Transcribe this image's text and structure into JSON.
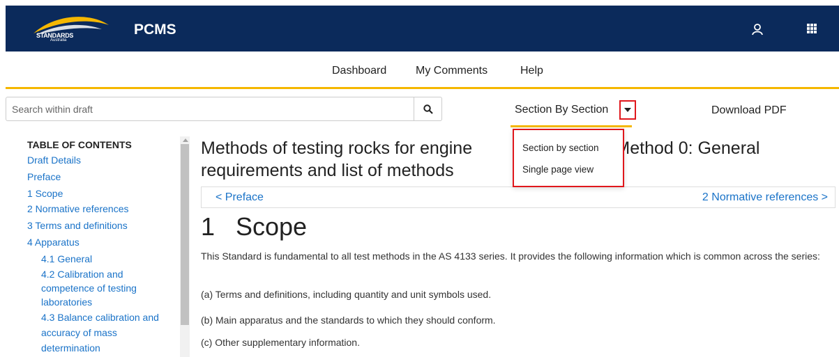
{
  "header": {
    "logo_text": "STANDARDS",
    "logo_subtext": "Australia",
    "app_title": "PCMS",
    "user_icon": "user-icon",
    "apps_icon": "apps-grid-icon",
    "bg_color": "#0b2a5b",
    "accent_color": "#f5b700"
  },
  "nav": {
    "items": [
      "Dashboard",
      "My Comments",
      "Help"
    ]
  },
  "toolbar": {
    "search_placeholder": "Search within draft",
    "search_icon": "search-icon",
    "view_mode_label": "Section By Section",
    "caret_icon": "caret-down-icon",
    "download_label": "Download PDF",
    "highlight_color": "#e0171c"
  },
  "view_dropdown": {
    "options": [
      "Section by section",
      "Single page view"
    ]
  },
  "toc": {
    "heading": "TABLE OF CONTENTS",
    "items": [
      {
        "label": "Draft Details"
      },
      {
        "label": "Preface"
      },
      {
        "label": "1 Scope"
      },
      {
        "label": "2 Normative references"
      },
      {
        "label": "3 Terms and definitions"
      },
      {
        "label": "4 Apparatus"
      },
      {
        "label": "4.1 General"
      },
      {
        "label": "4.2 Calibration and"
      },
      {
        "label": "competence of testing"
      },
      {
        "label": "laboratories"
      },
      {
        "label": "4.3 Balance calibration and"
      },
      {
        "label": "accuracy of mass"
      },
      {
        "label": "determination"
      }
    ]
  },
  "document": {
    "title_part1": "Methods of testing rocks for engine",
    "title_part2": "es, Method 0: General",
    "title_line2": "requirements and list of methods",
    "prev_link": "< Preface",
    "next_link": "2 Normative references >",
    "section_number": "1",
    "section_title": "Scope",
    "paragraphs": [
      "This Standard is fundamental to all test methods in the AS 4133 series. It provides the following information which is common across the series:",
      "(a) Terms and definitions, including quantity and unit symbols used.",
      "(b) Main apparatus and the standards to which they should conform.",
      "(c) Other supplementary information."
    ]
  }
}
